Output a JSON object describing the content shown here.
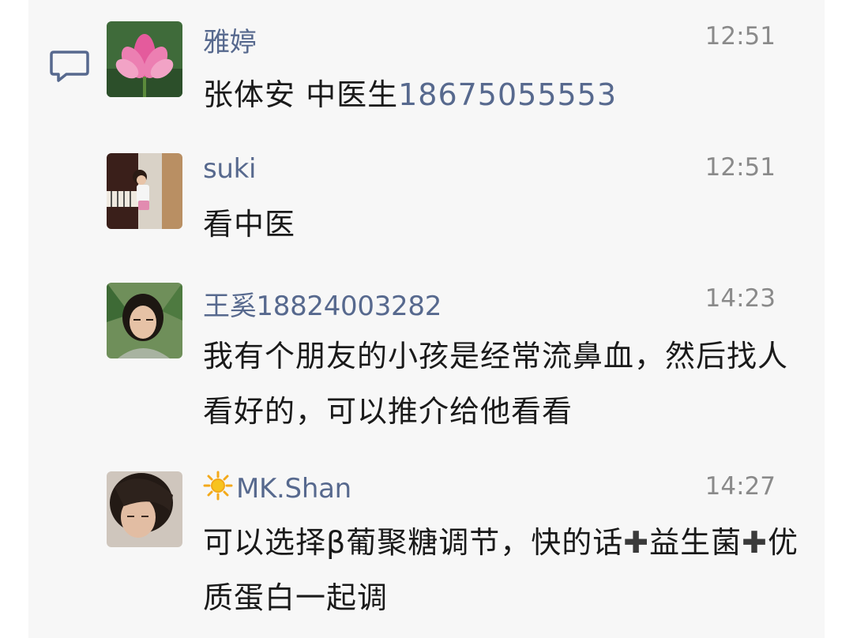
{
  "comments": [
    {
      "name": "雅婷",
      "time": "12:51",
      "text_plain": "张体安 中医生",
      "text_phone": "18675055553"
    },
    {
      "name": "suki",
      "time": "12:51",
      "text": "看中医"
    },
    {
      "name": "王奚18824003282",
      "time": "14:23",
      "text": "我有个朋友的小孩是经常流鼻血，然后找人看好的，可以推介给他看看"
    },
    {
      "name": "MK.Shan",
      "time": "14:27",
      "text_a": "可以选择β葡聚糖调节，快的话",
      "plus": "✚",
      "text_b": "益生菌",
      "text_c": "优质蛋白一起调"
    }
  ],
  "icons": {
    "comment": "comment-bubble-icon",
    "sun": "sun-emoji-icon"
  },
  "colors": {
    "name": "#57698e",
    "time": "#8a8a8a",
    "panel": "#f7f7f7",
    "text": "#1a1a1a"
  }
}
